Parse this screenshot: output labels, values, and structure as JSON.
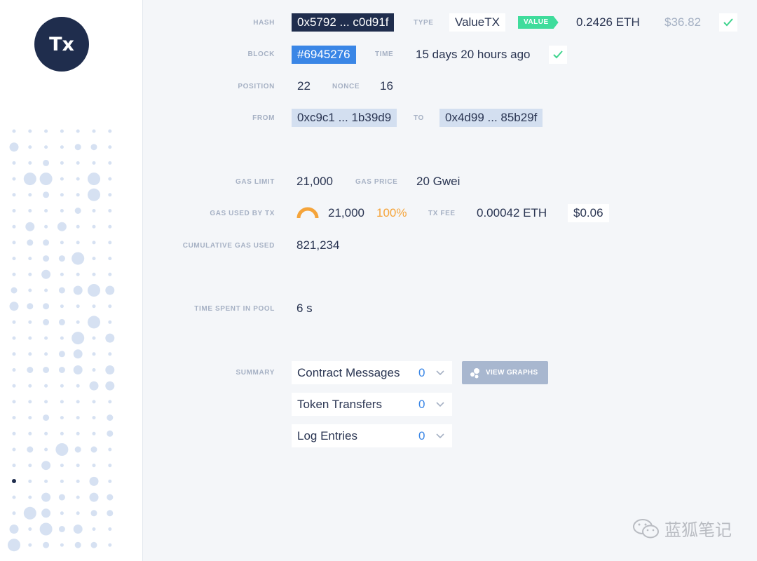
{
  "sidebar": {
    "avatar_text": "Tx"
  },
  "tx": {
    "hash_label": "HASH",
    "hash": "0x5792 ... c0d91f",
    "type_label": "TYPE",
    "type": "ValueTX",
    "value_tag": "VALUE",
    "value_eth": "0.2426 ETH",
    "value_usd": "$36.82",
    "block_label": "BLOCK",
    "block": "#6945276",
    "time_label": "TIME",
    "time": "15 days 20 hours ago",
    "position_label": "POSITION",
    "position": "22",
    "nonce_label": "NONCE",
    "nonce": "16",
    "from_label": "FROM",
    "from": "0xc9c1 ... 1b39d9",
    "to_label": "TO",
    "to": "0x4d99 ... 85b29f",
    "gas_limit_label": "GAS LIMIT",
    "gas_limit": "21,000",
    "gas_price_label": "GAS PRICE",
    "gas_price": "20 Gwei",
    "gas_used_label": "GAS USED BY TX",
    "gas_used": "21,000",
    "gas_used_pct": "100%",
    "tx_fee_label": "TX FEE",
    "tx_fee": "0.00042 ETH",
    "tx_fee_usd": "$0.06",
    "cumulative_label": "CUMULATIVE GAS USED",
    "cumulative": "821,234",
    "pool_label": "TIME SPENT IN POOL",
    "pool": "6 s"
  },
  "summary": {
    "label": "SUMMARY",
    "items": [
      {
        "name": "Contract Messages",
        "count": "0"
      },
      {
        "name": "Token Transfers",
        "count": "0"
      },
      {
        "name": "Log Entries",
        "count": "0"
      }
    ],
    "graphs_button": "VIEW GRAPHS"
  },
  "watermark": {
    "text": "蓝狐笔记"
  },
  "colors": {
    "accent_blue": "#3a86e6",
    "navy": "#1f2d4d",
    "green": "#3fdc9c",
    "orange": "#f5a43a"
  }
}
